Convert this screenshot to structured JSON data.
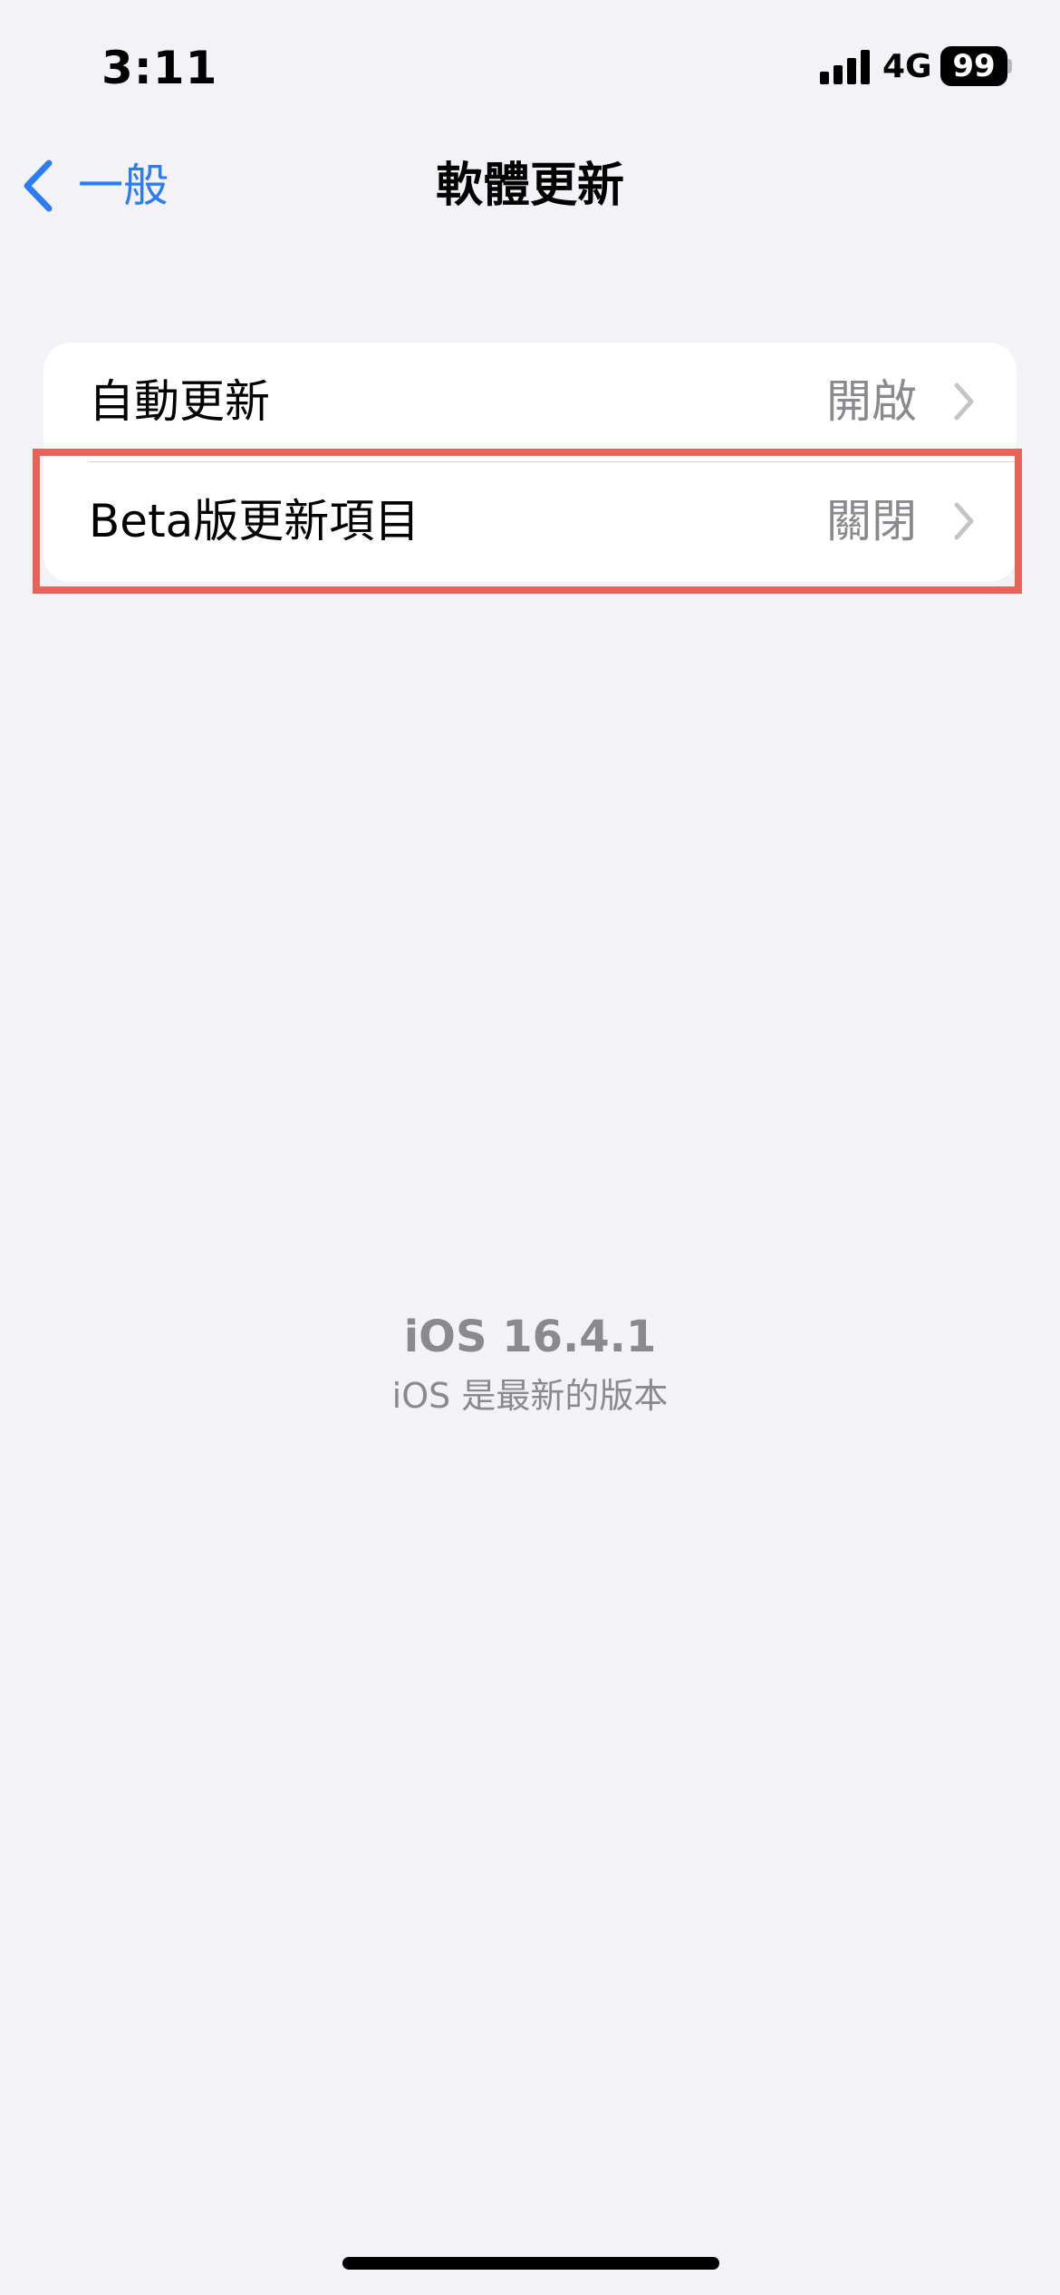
{
  "status_bar": {
    "time": "3:11",
    "network": "4G",
    "battery": "99"
  },
  "nav": {
    "back_label": "一般",
    "title": "軟體更新"
  },
  "settings": {
    "rows": [
      {
        "label": "自動更新",
        "value": "開啟"
      },
      {
        "label": "Beta版更新項目",
        "value": "關閉"
      }
    ]
  },
  "version": {
    "title": "iOS 16.4.1",
    "subtitle": "iOS 是最新的版本"
  },
  "colors": {
    "accent": "#2c7cf6",
    "background": "#f2f2f7",
    "highlight": "#e8625a",
    "secondary_text": "#8a8a8e"
  },
  "icons": [
    "signal-icon",
    "battery-icon",
    "chevron-left-icon",
    "chevron-right-icon"
  ]
}
